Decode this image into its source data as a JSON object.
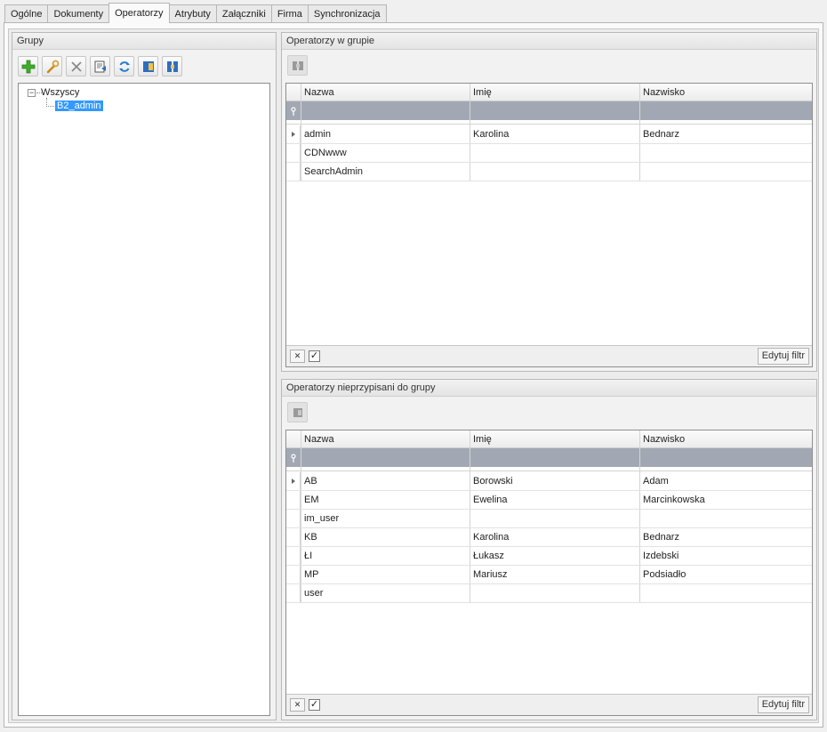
{
  "tabs": [
    "Ogólne",
    "Dokumenty",
    "Operatorzy",
    "Atrybuty",
    "Załączniki",
    "Firma",
    "Synchronizacja"
  ],
  "active_tab": "Operatorzy",
  "groups_panel": {
    "title": "Grupy",
    "toolbar": [
      {
        "name": "add-icon"
      },
      {
        "name": "edit-wrench-icon"
      },
      {
        "name": "delete-x-icon"
      },
      {
        "name": "export-icon"
      },
      {
        "name": "refresh-icon"
      },
      {
        "name": "import-icon"
      },
      {
        "name": "assign-icon"
      }
    ],
    "tree": {
      "root": "Wszyscy",
      "children": [
        "B2_admin"
      ],
      "selected": "B2_admin"
    }
  },
  "in_group": {
    "title": "Operatorzy w grupie",
    "columns": [
      "Nazwa",
      "Imię",
      "Nazwisko"
    ],
    "rows": [
      [
        "admin",
        "Karolina",
        "Bednarz"
      ],
      [
        "CDNwww",
        "",
        ""
      ],
      [
        "SearchAdmin",
        "",
        ""
      ]
    ],
    "edit_filter": "Edytuj filtr"
  },
  "not_in_group": {
    "title": "Operatorzy nieprzypisani do grupy",
    "columns": [
      "Nazwa",
      "Imię",
      "Nazwisko"
    ],
    "rows": [
      [
        "AB",
        "Borowski",
        "Adam"
      ],
      [
        "EM",
        "Ewelina",
        "Marcinkowska"
      ],
      [
        "im_user",
        "",
        ""
      ],
      [
        "KB",
        "Karolina",
        "Bednarz"
      ],
      [
        "ŁI",
        "Łukasz",
        "Izdebski"
      ],
      [
        "MP",
        "Mariusz",
        "Podsiadło"
      ],
      [
        "user",
        "",
        ""
      ]
    ],
    "edit_filter": "Edytuj filtr"
  },
  "colors": {
    "selection": "#3399ff",
    "filter_row": "#a2a8b3"
  }
}
